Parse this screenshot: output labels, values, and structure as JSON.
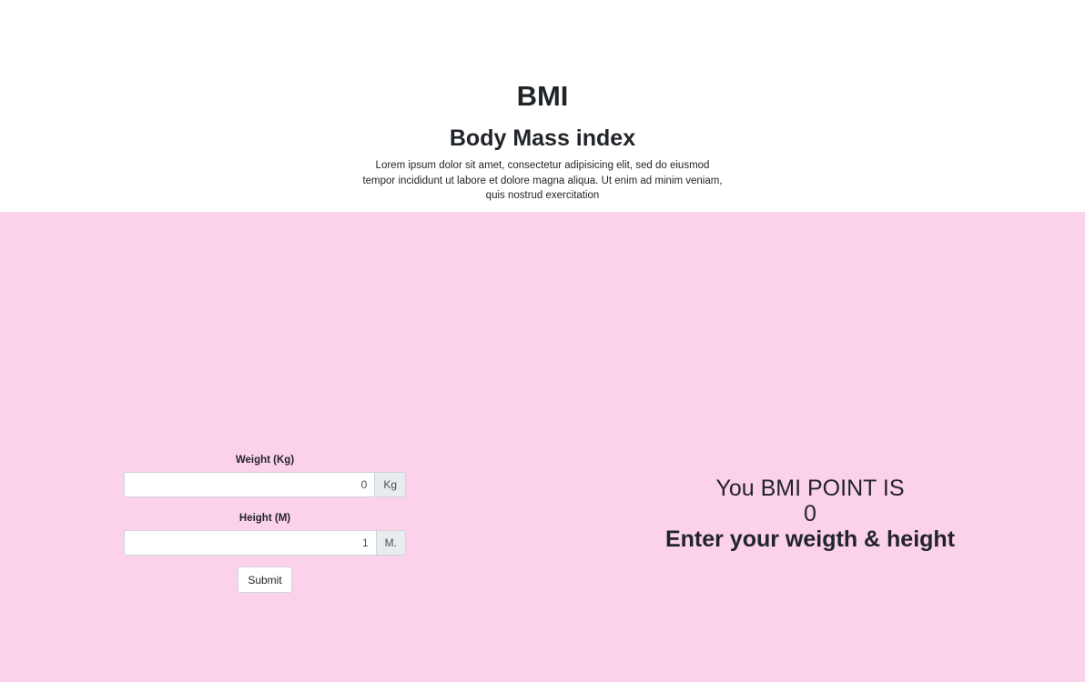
{
  "header": {
    "title": "BMI",
    "subtitle": "Body Mass index",
    "lead": "Lorem ipsum dolor sit amet, consectetur adipisicing elit, sed do eiusmod tempor incididunt ut labore et dolore magna aliqua. Ut enim ad minim veniam, quis nostrud exercitation"
  },
  "form": {
    "weight_label": "Weight (Kg)",
    "weight_value": "0",
    "weight_unit": "Kg",
    "height_label": "Height (M)",
    "height_value": "1",
    "height_unit": "M.",
    "submit_label": "Submit"
  },
  "result": {
    "heading": "You BMI POINT IS",
    "value": "0",
    "message": "Enter your weigth & height"
  },
  "colors": {
    "main_background": "#fcd1ea",
    "text": "#212529"
  }
}
